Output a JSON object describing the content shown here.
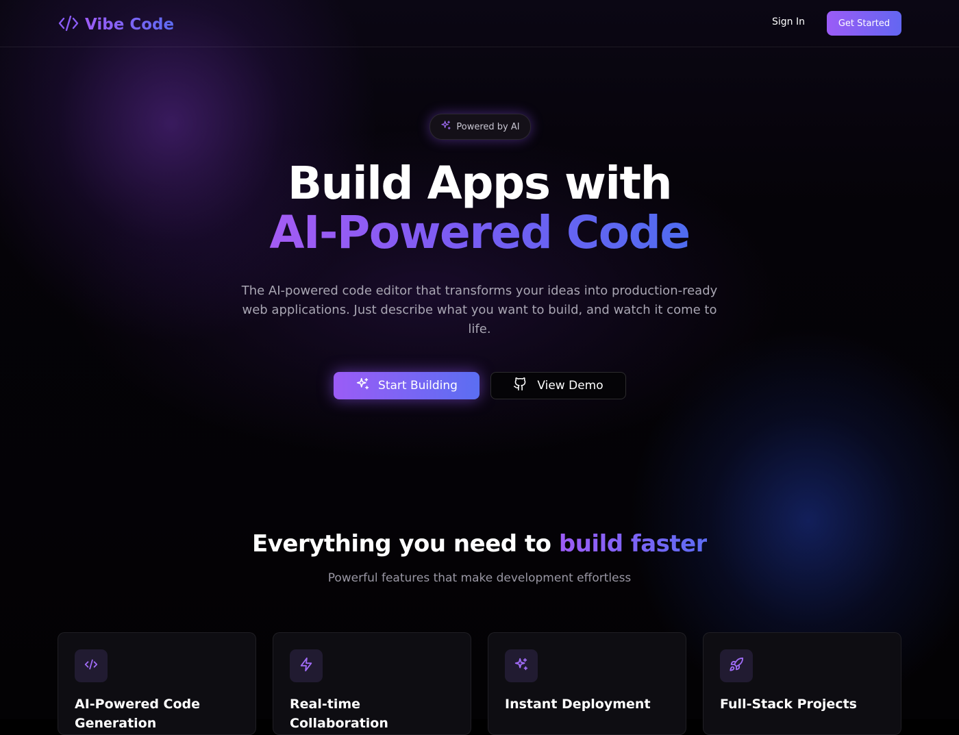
{
  "brand": {
    "name": "Vibe Code",
    "icon": "code-brackets-icon"
  },
  "nav": {
    "sign_in": "Sign In",
    "get_started": "Get Started"
  },
  "hero": {
    "badge": "Powered by AI",
    "title_line1": "Build Apps with",
    "title_line2": "AI-Powered Code",
    "subtitle": "The AI-powered code editor that transforms your ideas into production-ready web applications. Just describe what you want to build, and watch it come to life.",
    "primary_cta": "Start Building",
    "secondary_cta": "View Demo"
  },
  "features": {
    "title_prefix": "Everything you need to",
    "title_accent": "build faster",
    "subtitle": "Powerful features that make development effortless",
    "cards": [
      {
        "icon": "code-icon",
        "title": "AI-Powered Code Generation"
      },
      {
        "icon": "lightning-icon",
        "title": "Real-time Collaboration"
      },
      {
        "icon": "sparkles-icon",
        "title": "Instant Deployment"
      },
      {
        "icon": "rocket-icon",
        "title": "Full-Stack Projects"
      }
    ]
  },
  "colors": {
    "accent_purple": "#9b5cf6",
    "accent_blue": "#5b6ef2",
    "background": "#000000",
    "card_background": "#0e0d12"
  }
}
